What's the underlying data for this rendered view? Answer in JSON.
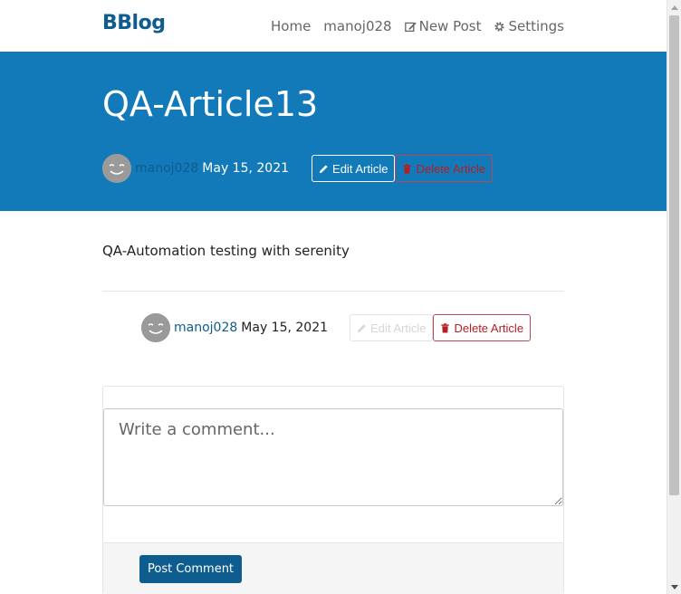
{
  "nav": {
    "brand": "BBlog",
    "links": [
      {
        "label": "Home",
        "icon": ""
      },
      {
        "label": "manoj028",
        "icon": ""
      },
      {
        "label": "New Post",
        "icon": "compose-icon"
      },
      {
        "label": "Settings",
        "icon": "gear-icon"
      }
    ]
  },
  "article": {
    "title": "QA-Article13",
    "author": "manoj028",
    "date": "May 15, 2021",
    "edit_label": "Edit Article",
    "delete_label": "Delete Article",
    "body": "QA-Automation testing with serenity"
  },
  "comment": {
    "placeholder": "Write a comment...",
    "submit_label": "Post Comment"
  },
  "colors": {
    "brand": "#0f5c8f",
    "banner": "#127ab9",
    "danger": "#b71d24"
  }
}
